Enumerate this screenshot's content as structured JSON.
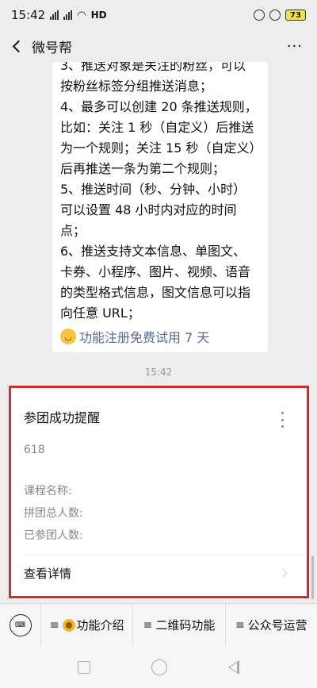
{
  "status_bar": {
    "time": "15:42",
    "network": "HD",
    "battery": "73"
  },
  "nav": {
    "title": "微号帮",
    "more": "···"
  },
  "message": {
    "lines": [
      "3、推送对象是关注的粉丝，可以",
      "按粉丝标签分组推送消息；",
      "4、最多可以创建 20 条推送规则，",
      "比如：关注 1 秒（自定义）后推送",
      "为一个规则；关注 15 秒（自定义）",
      "后再推送一条为第二个规则；",
      "5、推送时间（秒、分钟、小时）",
      "可以设置 48 小时内对应的时间",
      "点；",
      "6、推送支持文本信息、单图文、",
      "卡券、小程序、图片、视频、语音",
      "的类型格式信息，图文信息可以指",
      "向任意 URL；"
    ],
    "link_text": "功能注册免费试用 7 天"
  },
  "timestamp": "15:42",
  "card": {
    "title": "参团成功提醒",
    "value": "618",
    "fields": [
      "课程名称:",
      "拼团总人数:",
      "已参团人数:"
    ],
    "detail_label": "查看详情"
  },
  "menu": {
    "items": [
      "功能介绍",
      "二维码功能",
      "公众号运营"
    ]
  },
  "colors": {
    "link": "#576b95",
    "highlight_border": "#d52a2a",
    "battery": "#f0e04b"
  }
}
